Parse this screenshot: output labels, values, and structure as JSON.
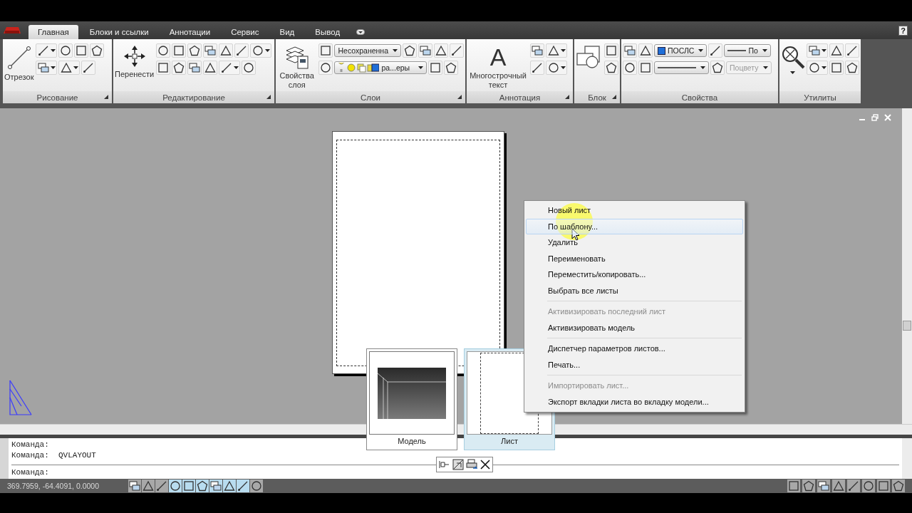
{
  "tabs": [
    {
      "label": "Главная",
      "selected": true
    },
    {
      "label": "Блоки и ссылки",
      "selected": false
    },
    {
      "label": "Аннотации",
      "selected": false
    },
    {
      "label": "Сервис",
      "selected": false
    },
    {
      "label": "Вид",
      "selected": false
    },
    {
      "label": "Вывод",
      "selected": false
    }
  ],
  "help": "?",
  "ribbon": {
    "panels": [
      {
        "title": "Рисование",
        "launcher": true,
        "large": {
          "kind": "line-tool",
          "label": "Отрезок"
        },
        "rows": [
          [
            {
              "kind": "icon_dropdown"
            },
            {
              "kind": "icon"
            },
            {
              "kind": "icon"
            },
            {
              "kind": "icon"
            }
          ],
          [
            {
              "kind": "icon_dropdown"
            },
            {
              "kind": "icon_dropdown"
            },
            {
              "kind": "icon"
            }
          ]
        ]
      },
      {
        "title": "Редактирование",
        "launcher": true,
        "large": {
          "kind": "move-tool",
          "label": "Перенести"
        },
        "rows": [
          [
            {
              "kind": "icon"
            },
            {
              "kind": "icon"
            },
            {
              "kind": "icon"
            },
            {
              "kind": "icon"
            },
            {
              "kind": "icon"
            },
            {
              "kind": "icon"
            },
            {
              "kind": "icon_dropdown"
            }
          ],
          [
            {
              "kind": "icon"
            },
            {
              "kind": "icon"
            },
            {
              "kind": "icon"
            },
            {
              "kind": "icon"
            },
            {
              "kind": "icon_dropdown"
            },
            {
              "kind": "icon"
            }
          ]
        ]
      },
      {
        "title": "Слои",
        "launcher": true,
        "large": {
          "kind": "layer-tool",
          "label": "Свойства слоя"
        },
        "rows": [
          [
            {
              "kind": "icon"
            },
            {
              "kind": "combo",
              "value": "Несохраненна",
              "disabled": false
            },
            {
              "kind": "icon"
            },
            {
              "kind": "icon"
            },
            {
              "kind": "icon"
            },
            {
              "kind": "icon"
            }
          ],
          [
            {
              "kind": "icon"
            },
            {
              "kind": "layer_combo",
              "value": "ра...еры",
              "disabled": false
            },
            {
              "kind": "icon"
            },
            {
              "kind": "icon"
            }
          ]
        ]
      },
      {
        "title": "Аннотация",
        "launcher": true,
        "large": {
          "kind": "text-tool",
          "glyph": "A",
          "label": "Многострочный текст"
        },
        "rows": [
          [
            {
              "kind": "icon"
            },
            {
              "kind": "icon_dropdown"
            }
          ],
          [
            {
              "kind": "icon"
            },
            {
              "kind": "icon_dropdown"
            }
          ]
        ]
      },
      {
        "title": "Блок",
        "launcher": true,
        "large": {
          "kind": "block-tool"
        },
        "rows": [
          [
            {
              "kind": "icon"
            }
          ],
          [
            {
              "kind": "icon"
            }
          ]
        ]
      },
      {
        "title": "Свойства",
        "launcher": false,
        "rows": [
          [
            {
              "kind": "icon"
            },
            {
              "kind": "icon"
            },
            {
              "kind": "color_combo",
              "value": "ПОСЛС",
              "disabled": false
            },
            {
              "kind": "icon"
            },
            {
              "kind": "line_combo",
              "value": "По",
              "disabled": false
            }
          ],
          [
            {
              "kind": "icon"
            },
            {
              "kind": "icon"
            },
            {
              "kind": "line_combo",
              "disabled": false
            },
            {
              "kind": "icon"
            },
            {
              "kind": "combo",
              "value": "Поцвету",
              "disabled": true
            }
          ]
        ]
      },
      {
        "title": "Утилиты",
        "launcher": false,
        "large": {
          "kind": "zoom-tool"
        },
        "rows": [
          [
            {
              "kind": "icon_dropdown"
            },
            {
              "kind": "icon"
            },
            {
              "kind": "icon"
            }
          ],
          [
            {
              "kind": "icon_dropdown"
            },
            {
              "kind": "icon"
            },
            {
              "kind": "icon"
            }
          ]
        ]
      }
    ]
  },
  "context_menu": {
    "groups": [
      [
        {
          "label": "Новый лист",
          "disabled": false,
          "hovered": false
        },
        {
          "label": "По шаблону...",
          "disabled": false,
          "hovered": true
        },
        {
          "label": "Удалить",
          "disabled": false,
          "hovered": false
        },
        {
          "label": "Переименовать",
          "disabled": false,
          "hovered": false
        },
        {
          "label": "Переместить/копировать...",
          "disabled": false,
          "hovered": false
        },
        {
          "label": "Выбрать все листы",
          "disabled": false,
          "hovered": false
        }
      ],
      [
        {
          "label": "Активизировать последний лист",
          "disabled": true,
          "hovered": false
        },
        {
          "label": "Активизировать модель",
          "disabled": false,
          "hovered": false
        }
      ],
      [
        {
          "label": "Диспетчер параметров листов...",
          "disabled": false,
          "hovered": false
        },
        {
          "label": "Печать...",
          "disabled": false,
          "hovered": false
        }
      ],
      [
        {
          "label": "Импортировать лист...",
          "disabled": true,
          "hovered": false
        },
        {
          "label": "Экспорт вкладки листа во вкладку модели...",
          "disabled": false,
          "hovered": false
        }
      ]
    ]
  },
  "layout_previews": [
    {
      "kind": "model",
      "label": "Модель",
      "selected": false
    },
    {
      "kind": "layout",
      "label": "Лист",
      "selected": true
    }
  ],
  "command_line": {
    "history": [
      "Команда:",
      "Команда:  QVLAYOUT"
    ],
    "prompt": "Команда:"
  },
  "status_bar": {
    "coordinates": "369.7959, -64.4091, 0.0000",
    "toggles": [
      {
        "on": false
      },
      {
        "on": false
      },
      {
        "on": false
      },
      {
        "on": true
      },
      {
        "on": true
      },
      {
        "on": true
      },
      {
        "on": true
      },
      {
        "on": true
      },
      {
        "on": true
      },
      {
        "on": false
      }
    ]
  }
}
